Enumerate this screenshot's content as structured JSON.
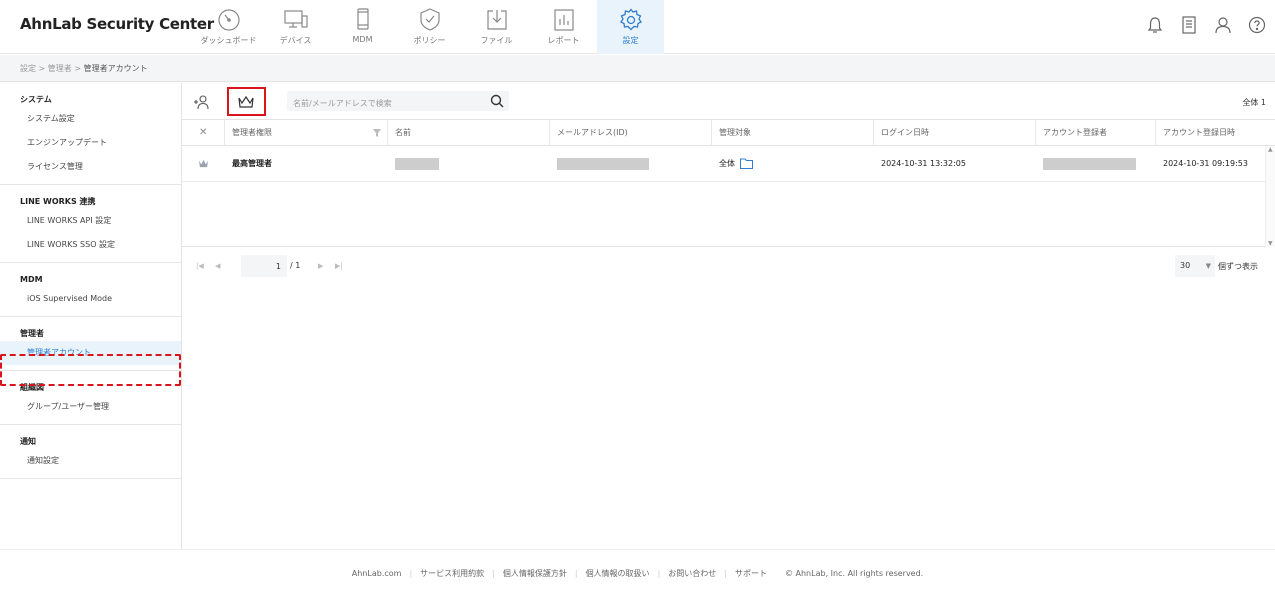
{
  "app": {
    "title": "AhnLab Security Center"
  },
  "nav": [
    {
      "id": "dashboard",
      "label": "ダッシュボード",
      "icon": "gauge-icon"
    },
    {
      "id": "device",
      "label": "デバイス",
      "icon": "monitor-icon"
    },
    {
      "id": "mdm",
      "label": "MDM",
      "icon": "phone-icon"
    },
    {
      "id": "policy",
      "label": "ポリシー",
      "icon": "shield-check-icon"
    },
    {
      "id": "file",
      "label": "ファイル",
      "icon": "download-box-icon"
    },
    {
      "id": "report",
      "label": "レポート",
      "icon": "bar-report-icon"
    },
    {
      "id": "settings",
      "label": "設定",
      "icon": "gear-icon",
      "active": true
    }
  ],
  "breadcrumb": {
    "part1": "設定",
    "sep": ">",
    "part2": "管理者",
    "part3": "管理者アカウント"
  },
  "sidebar": [
    {
      "title": "システム",
      "items": [
        "システム設定",
        "エンジンアップデート",
        "ライセンス管理"
      ]
    },
    {
      "title": "LINE WORKS 連携",
      "items": [
        "LINE WORKS API 設定",
        "LINE WORKS SSO 設定"
      ]
    },
    {
      "title": "MDM",
      "items": [
        "iOS Supervised Mode"
      ]
    },
    {
      "title": "管理者",
      "items": [
        "管理者アカウント"
      ]
    },
    {
      "title": "組織図",
      "items": [
        "グループ/ユーザー管理"
      ]
    },
    {
      "title": "通知",
      "items": [
        "通知設定"
      ]
    }
  ],
  "toolbar": {
    "search_placeholder": "名前/メールアドレスで検索",
    "total": "全体 1"
  },
  "table": {
    "headers": [
      "管理者権限",
      "名前",
      "メールアドレス(ID)",
      "管理対象",
      "ログイン日時",
      "アカウント登録者",
      "アカウント登録日時"
    ],
    "rows": [
      {
        "role": "最高管理者",
        "target": "全体",
        "login": "2024-10-31 13:32:05",
        "registered": "2024-10-31 09:19:53"
      }
    ]
  },
  "pager": {
    "page": "1",
    "total": "/ 1",
    "size": "30",
    "size_label": "個ずつ表示"
  },
  "footer": [
    "AhnLab.com",
    "サービス利用約款",
    "個人情報保護方針",
    "個人情報の取扱い",
    "お問い合わせ",
    "サポート",
    "© AhnLab, Inc. All rights reserved."
  ],
  "colors": {
    "accent": "#2f7fd0",
    "highlight": "#d9151b",
    "active_bg": "#e9f3fb"
  }
}
